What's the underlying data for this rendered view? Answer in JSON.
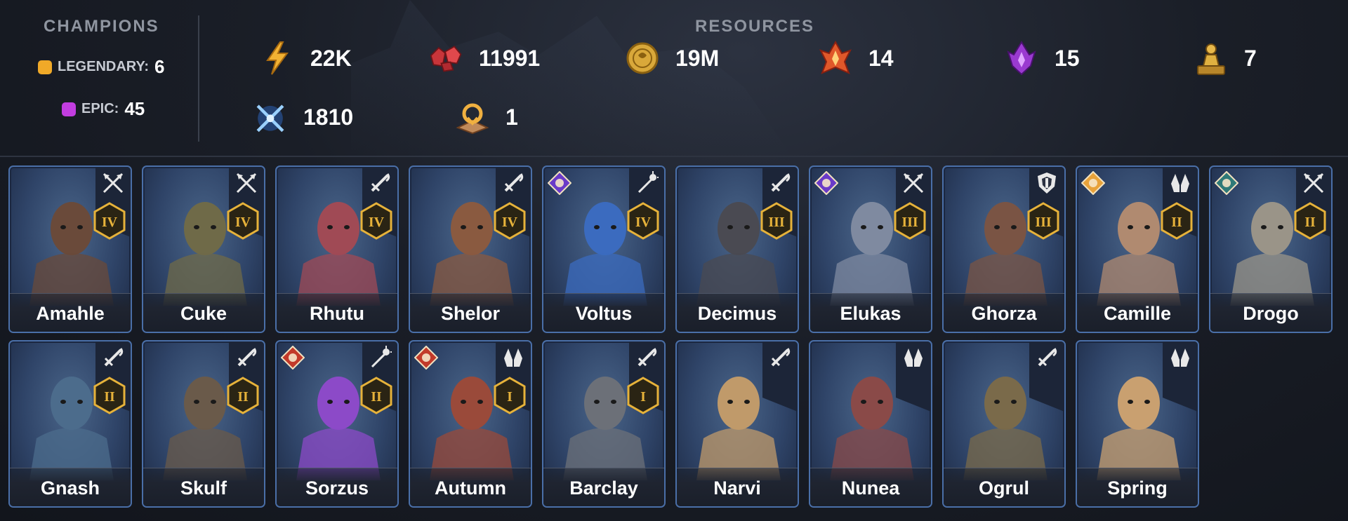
{
  "champions": {
    "title": "CHAMPIONS",
    "legendary": {
      "label": "LEGENDARY:",
      "count": "6",
      "color": "#f0a928"
    },
    "epic": {
      "label": "EPIC:",
      "count": "45",
      "color": "#c23de0"
    }
  },
  "resources": {
    "title": "RESOURCES",
    "items": [
      {
        "icon": "energy-icon",
        "value": "22K"
      },
      {
        "icon": "ruby-gems-icon",
        "value": "11991"
      },
      {
        "icon": "silver-coin-icon",
        "value": "19M"
      },
      {
        "icon": "fire-shard-icon",
        "value": "14"
      },
      {
        "icon": "void-shard-icon",
        "value": "15"
      },
      {
        "icon": "gold-statue-icon",
        "value": "7"
      },
      {
        "icon": "arena-tokens-icon",
        "value": "1810"
      },
      {
        "icon": "tome-icon",
        "value": "1"
      }
    ]
  },
  "cards": [
    {
      "name": "Amahle",
      "rank": "IV",
      "role": "arrows-icon",
      "affinity": "",
      "skin": "#6a4a3a"
    },
    {
      "name": "Cuke",
      "rank": "IV",
      "role": "arrows-icon",
      "affinity": "",
      "skin": "#6f6a48"
    },
    {
      "name": "Rhutu",
      "rank": "IV",
      "role": "sword-icon",
      "affinity": "",
      "skin": "#a04a55"
    },
    {
      "name": "Shelor",
      "rank": "IV",
      "role": "sword-icon",
      "affinity": "",
      "skin": "#8a5a40"
    },
    {
      "name": "Voltus",
      "rank": "IV",
      "role": "staff-icon",
      "affinity": "void",
      "skin": "#3b6bbf"
    },
    {
      "name": "Decimus",
      "rank": "III",
      "role": "sword-icon",
      "affinity": "",
      "skin": "#4a4a52"
    },
    {
      "name": "Elukas",
      "rank": "III",
      "role": "arrows-icon",
      "affinity": "void",
      "skin": "#7f8aa0"
    },
    {
      "name": "Ghorza",
      "rank": "III",
      "role": "shield-icon",
      "affinity": "",
      "skin": "#7a5444"
    },
    {
      "name": "Camille",
      "rank": "II",
      "role": "hands-icon",
      "affinity": "spirit",
      "skin": "#b08a70"
    },
    {
      "name": "Drogo",
      "rank": "II",
      "role": "arrows-icon",
      "affinity": "force",
      "skin": "#9a9488"
    },
    {
      "name": "Gnash",
      "rank": "II",
      "role": "sword-icon",
      "affinity": "",
      "skin": "#4c6c8c"
    },
    {
      "name": "Skulf",
      "rank": "II",
      "role": "sword-icon",
      "affinity": "",
      "skin": "#6a5a4a"
    },
    {
      "name": "Sorzus",
      "rank": "II",
      "role": "staff-icon",
      "affinity": "magic",
      "skin": "#8c4ac8"
    },
    {
      "name": "Autumn",
      "rank": "I",
      "role": "hands-icon",
      "affinity": "magic",
      "skin": "#9a4a3a"
    },
    {
      "name": "Barclay",
      "rank": "I",
      "role": "sword-icon",
      "affinity": "",
      "skin": "#6c7078"
    },
    {
      "name": "Narvi",
      "rank": "",
      "role": "sword-icon",
      "affinity": "",
      "skin": "#c09a6a"
    },
    {
      "name": "Nunea",
      "rank": "",
      "role": "hands-icon",
      "affinity": "",
      "skin": "#8a4a48"
    },
    {
      "name": "Ogrul",
      "rank": "",
      "role": "sword-icon",
      "affinity": "",
      "skin": "#7a6a4a"
    },
    {
      "name": "Spring",
      "rank": "",
      "role": "hands-icon",
      "affinity": "",
      "skin": "#c9a070"
    }
  ],
  "colors": {
    "rank_gold": "#e6b23a",
    "card_border": "#4a6fa8",
    "void": "#6a3ac8",
    "spirit": "#e8a23a",
    "force": "#2f7a78",
    "magic": "#c23a2a"
  }
}
